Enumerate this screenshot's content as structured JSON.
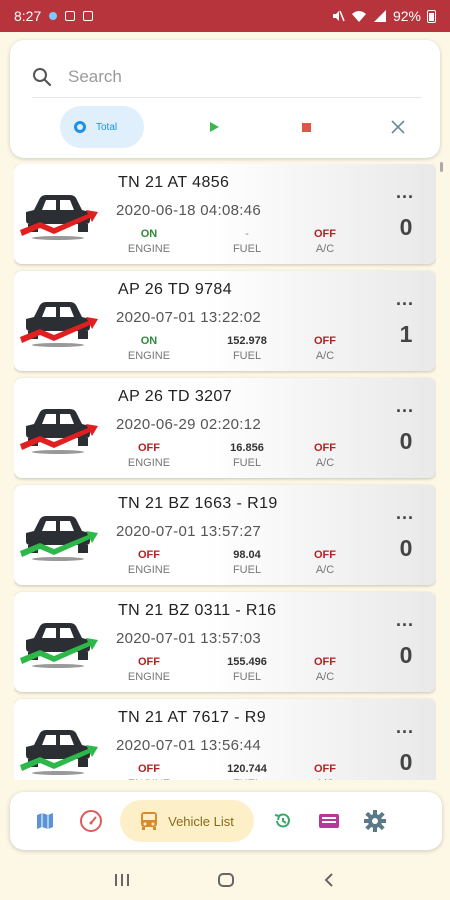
{
  "status_bar": {
    "time": "8:27",
    "battery": "92%"
  },
  "search": {
    "placeholder": "Search",
    "value": ""
  },
  "filters": {
    "total_label": "Total"
  },
  "vehicles": [
    {
      "plate": "TN 21 AT 4856",
      "timestamp": "2020-06-18 04:08:46",
      "engine": "ON",
      "fuel": "-",
      "ac": "OFF",
      "count": "0",
      "trend": "red"
    },
    {
      "plate": "AP 26 TD 9784",
      "timestamp": "2020-07-01 13:22:02",
      "engine": "ON",
      "fuel": "152.978",
      "ac": "OFF",
      "count": "1",
      "trend": "red"
    },
    {
      "plate": "AP 26 TD 3207",
      "timestamp": "2020-06-29 02:20:12",
      "engine": "OFF",
      "fuel": "16.856",
      "ac": "OFF",
      "count": "0",
      "trend": "red"
    },
    {
      "plate": "TN 21 BZ 1663 - R19",
      "timestamp": "2020-07-01 13:57:27",
      "engine": "OFF",
      "fuel": "98.04",
      "ac": "OFF",
      "count": "0",
      "trend": "green"
    },
    {
      "plate": "TN 21 BZ 0311 - R16",
      "timestamp": "2020-07-01 13:57:03",
      "engine": "OFF",
      "fuel": "155.496",
      "ac": "OFF",
      "count": "0",
      "trend": "green"
    },
    {
      "plate": "TN 21 AT 7617 - R9",
      "timestamp": "2020-07-01 13:56:44",
      "engine": "OFF",
      "fuel": "120.744",
      "ac": "OFF",
      "count": "0",
      "trend": "green"
    }
  ],
  "labels": {
    "engine": "ENGINE",
    "fuel": "FUEL",
    "ac": "A/C",
    "more": "..."
  },
  "nav": {
    "active_label": "Vehicle List"
  },
  "colors": {
    "status_bar": "#b8343d",
    "on": "#2e8b3a",
    "off": "#b22222",
    "accent": "#1e90e6",
    "trend_red": "#e02020",
    "trend_green": "#2eb84a"
  }
}
